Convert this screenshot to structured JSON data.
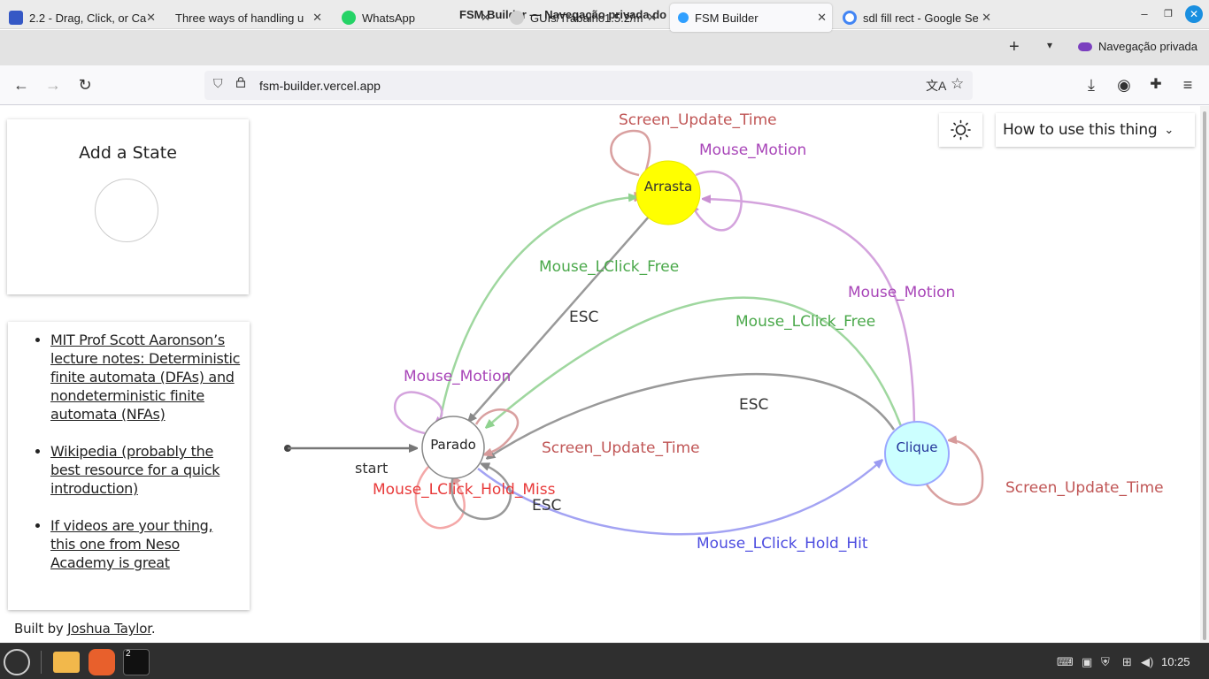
{
  "window": {
    "title": "FSM Builder — Navegação privada do Mozilla Firefox"
  },
  "tabs": [
    {
      "label": "2.2 - Drag, Click, or Ca",
      "icon": "moodle-icon",
      "color": "#3558c5"
    },
    {
      "label": "Three ways of handling u",
      "icon": "page-icon",
      "color": "#e3e3e3"
    },
    {
      "label": "WhatsApp",
      "icon": "whatsapp-icon",
      "color": "#25d366"
    },
    {
      "label": "GUIs/Trabalho1.5.2/m",
      "icon": "github-icon",
      "color": "#333333"
    },
    {
      "label": "FSM Builder",
      "icon": "fsm-icon",
      "color": "#2f9fff"
    },
    {
      "label": "sdl fill rect - Google Se",
      "icon": "google-icon",
      "color": "#4285f4"
    }
  ],
  "private_label": "Navegação privada",
  "url": "fsm-builder.vercel.app",
  "page": {
    "add_state_title": "Add a State",
    "links": [
      "MIT Prof Scott Aaronson’s lecture notes: Deterministic finite automata (DFAs) and nondeterministic finite automata (NFAs)",
      "Wikipedia (probably the best resource for a quick introduction)",
      "If videos are your thing, this one from Neso Academy is great"
    ],
    "built_prefix": "Built by ",
    "built_author": "Joshua Taylor",
    "built_suffix": ".",
    "howto_label": "How to use this thing"
  },
  "fsm": {
    "start_label": "start",
    "states": [
      {
        "name": "Parado",
        "fill": "#ffffff"
      },
      {
        "name": "Arrasta",
        "fill": "#ffff00"
      },
      {
        "name": "Clique",
        "fill": "#ccffff"
      }
    ],
    "transitions": {
      "arrasta_self_update": "Screen_Update_Time",
      "arrasta_self_motion": "Mouse_Motion",
      "parado_to_arrasta": "Mouse_LClick_Free",
      "arrasta_to_parado": "ESC",
      "clique_to_arrasta": "Mouse_Motion",
      "clique_to_parado_free": "Mouse_LClick_Free",
      "clique_to_parado_esc": "ESC",
      "parado_self_motion": "Mouse_Motion",
      "parado_self_update": "Screen_Update_Time",
      "parado_self_miss": "Mouse_LClick_Hold_Miss",
      "parado_self_esc": "ESC",
      "parado_to_clique": "Mouse_LClick_Hold_Hit",
      "clique_self_update": "Screen_Update_Time"
    },
    "colors": {
      "gray": "#888888",
      "green": "#55bb55",
      "purple": "#aa44bb",
      "red": "#cc5555",
      "bright_red": "#ee3333",
      "blue": "#5555ee"
    }
  },
  "taskbar": {
    "workspace": "2",
    "time": "10:25"
  }
}
